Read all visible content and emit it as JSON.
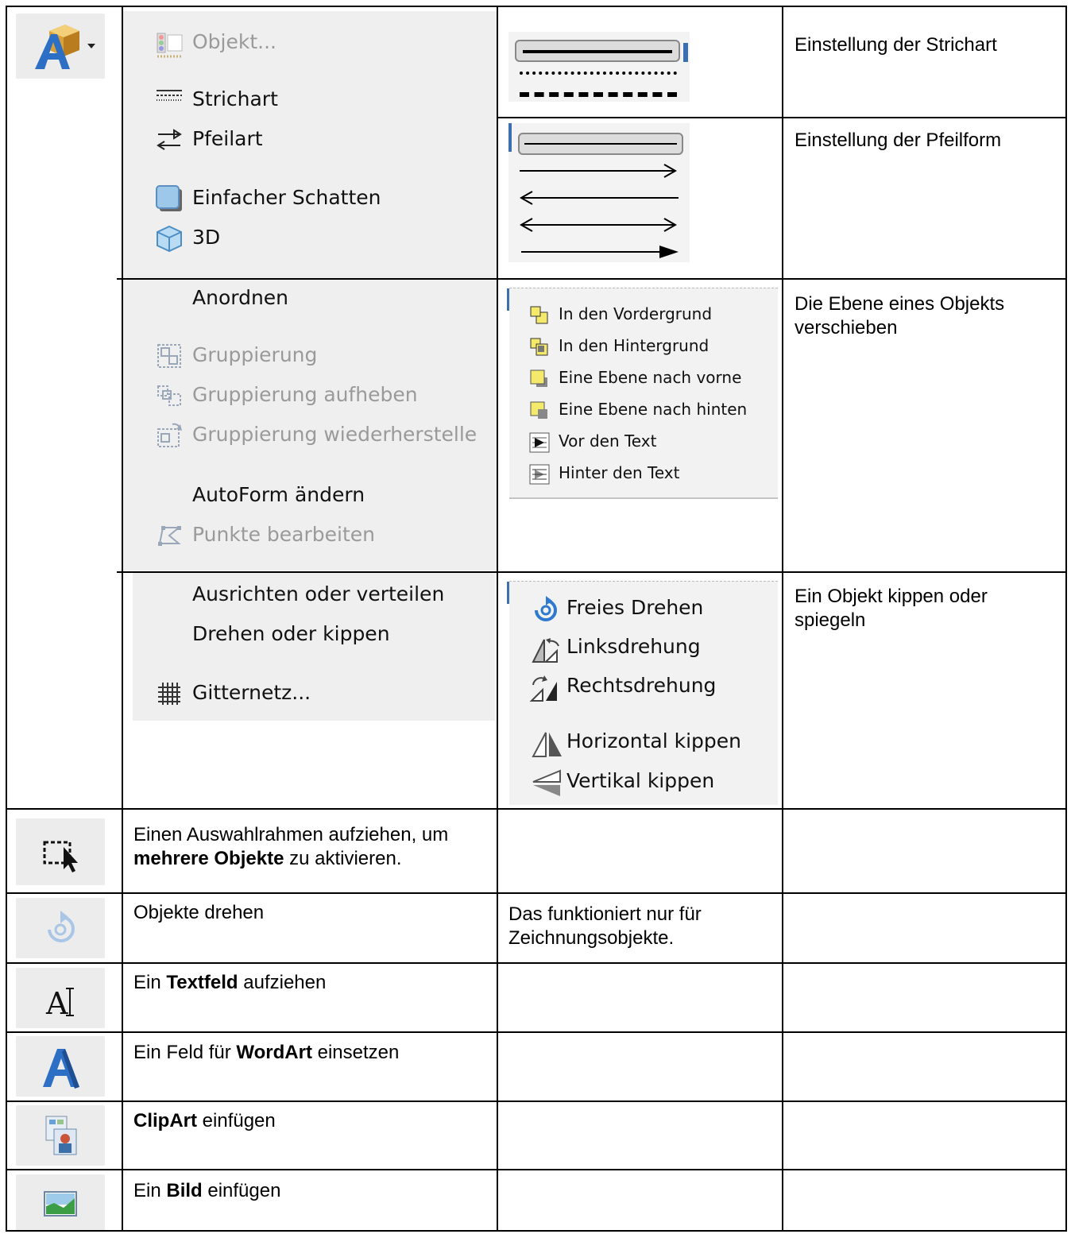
{
  "main_table": {
    "draw_menu": {
      "items": [
        {
          "label": "Objekt...",
          "icon": "object-icon",
          "disabled": true
        },
        {
          "label": "Strichart",
          "icon": "line-style-icon",
          "disabled": false
        },
        {
          "label": "Pfeilart",
          "icon": "arrow-style-icon",
          "disabled": false
        },
        {
          "label": "Einfacher Schatten",
          "icon": "shadow-icon",
          "disabled": false
        },
        {
          "label": "3D",
          "icon": "3d-cube-icon",
          "disabled": false
        }
      ],
      "arrange_items": [
        {
          "label": "Anordnen",
          "disabled": false
        },
        {
          "label": "Gruppierung",
          "icon": "group-icon",
          "disabled": true
        },
        {
          "label": "Gruppierung aufheben",
          "icon": "ungroup-icon",
          "disabled": true
        },
        {
          "label": "Gruppierung wiederherstelle",
          "icon": "regroup-icon",
          "disabled": true
        },
        {
          "label": "AutoForm ändern",
          "disabled": false
        },
        {
          "label": "Punkte bearbeiten",
          "icon": "edit-points-icon",
          "disabled": true
        }
      ],
      "align_items": [
        {
          "label": "Ausrichten oder verteilen",
          "disabled": false
        },
        {
          "label": "Drehen oder kippen",
          "disabled": false
        },
        {
          "label": "Gitternetz...",
          "icon": "grid-icon",
          "disabled": false
        }
      ]
    },
    "descriptions": {
      "strichart": "Einstellung der Strichart",
      "pfeilform": "Einstellung der Pfeilform",
      "ebene": "Die Ebene eines Objekts verschieben",
      "kippen": "Ein Objekt kippen oder spiegeln"
    },
    "order_submenu": [
      {
        "label": "In den Vordergrund",
        "icon": "bring-to-front-icon"
      },
      {
        "label": "In den Hintergrund",
        "icon": "send-to-back-icon"
      },
      {
        "label": "Eine Ebene nach vorne",
        "icon": "bring-forward-icon"
      },
      {
        "label": "Eine Ebene nach hinten",
        "icon": "send-backward-icon"
      },
      {
        "label": "Vor den Text",
        "icon": "in-front-of-text-icon"
      },
      {
        "label": "Hinter den Text",
        "icon": "behind-text-icon"
      }
    ],
    "rotate_submenu": [
      {
        "label": "Freies Drehen",
        "icon": "free-rotate-icon"
      },
      {
        "label": "Linksdrehung",
        "icon": "rotate-left-icon"
      },
      {
        "label": "Rechtsdrehung",
        "icon": "rotate-right-icon"
      },
      {
        "label": "Horizontal kippen",
        "icon": "flip-horizontal-icon"
      },
      {
        "label": "Vertikal kippen",
        "icon": "flip-vertical-icon"
      }
    ],
    "rows": [
      {
        "icon": "select-frame-icon",
        "pre": "Einen Auswahlrahmen aufziehen, um ",
        "bold": "mehrere Objekte",
        "post": " zu aktivieren.",
        "note": ""
      },
      {
        "icon": "rotate-objects-icon",
        "pre": "Objekte drehen",
        "bold": "",
        "post": "",
        "note": "Das funktioniert nur für Zeichnungsobjekte."
      },
      {
        "icon": "textbox-icon",
        "pre": "Ein ",
        "bold": "Textfeld",
        "post": " aufziehen",
        "note": ""
      },
      {
        "icon": "wordart-icon",
        "pre": "Ein Feld für ",
        "bold": "WordArt",
        "post": " einsetzen",
        "note": ""
      },
      {
        "icon": "clipart-icon",
        "pre": "",
        "bold": "ClipArt",
        "post": " einfügen",
        "note": ""
      },
      {
        "icon": "picture-icon",
        "pre": "Ein ",
        "bold": "Bild",
        "post": " einfügen",
        "note": ""
      }
    ]
  }
}
